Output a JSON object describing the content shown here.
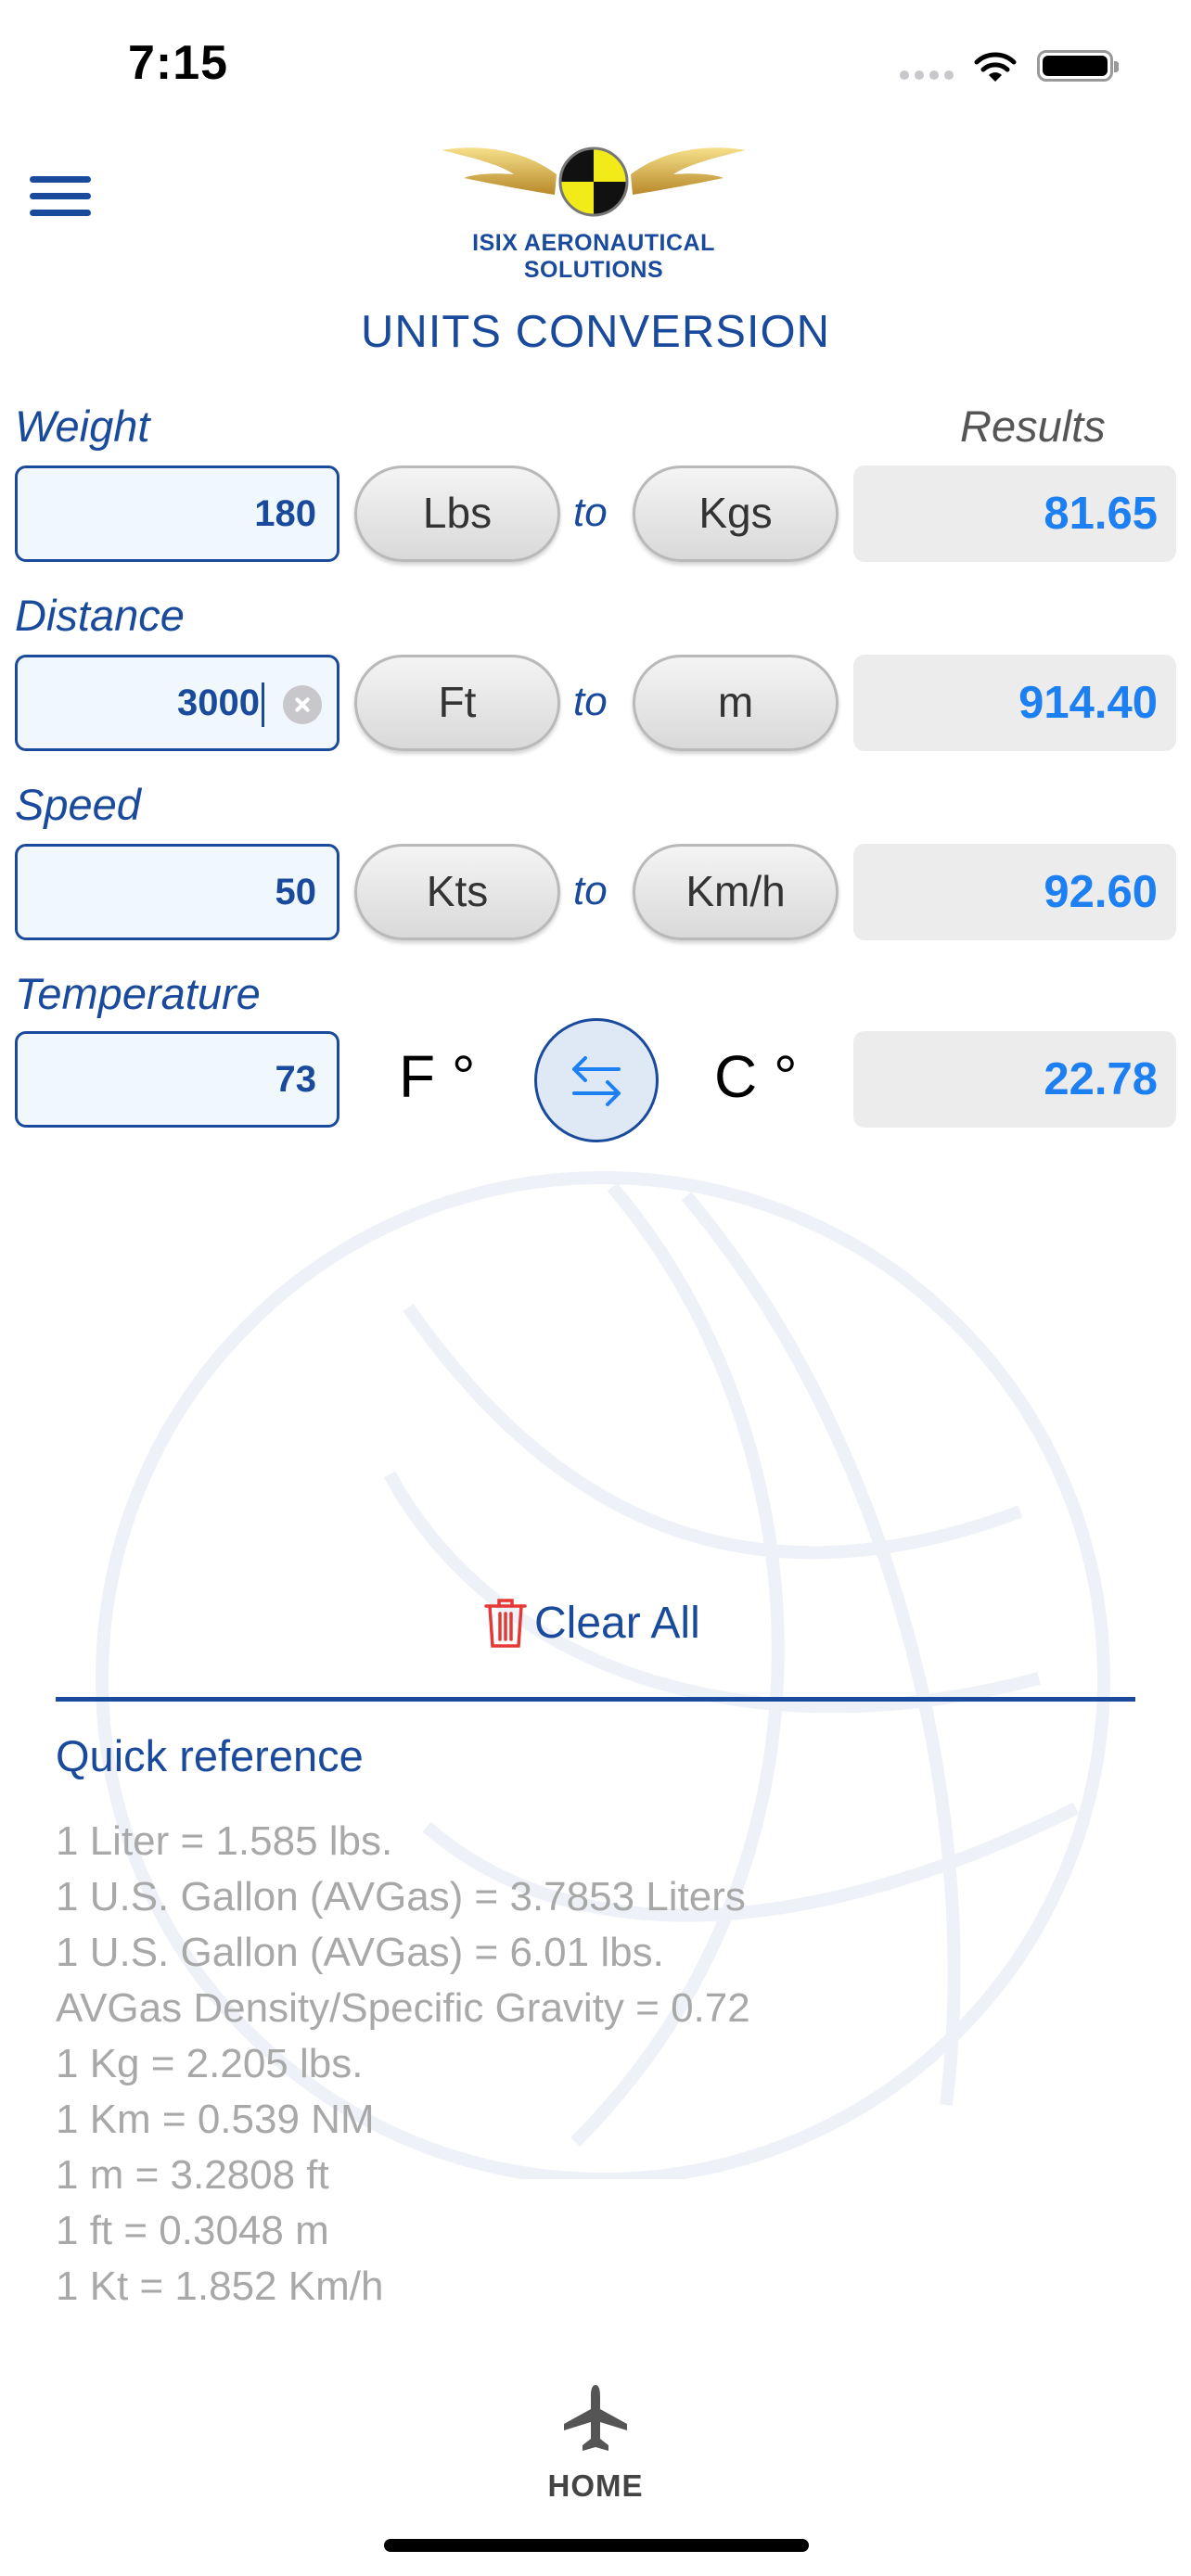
{
  "status_bar": {
    "time": "7:15"
  },
  "header": {
    "logo_text": "ISIX   AERONAUTICAL SOLUTIONS",
    "title": "UNITS CONVERSION"
  },
  "converter": {
    "results_label": "Results",
    "rows": [
      {
        "label": "Weight",
        "input": "180",
        "from_unit": "Lbs",
        "to": "to",
        "to_unit": "Kgs",
        "result": "81.65"
      },
      {
        "label": "Distance",
        "input": "3000",
        "from_unit": "Ft",
        "to": "to",
        "to_unit": "m",
        "result": "914.40"
      },
      {
        "label": "Speed",
        "input": "50",
        "from_unit": "Kts",
        "to": "to",
        "to_unit": "Km/h",
        "result": "92.60"
      }
    ],
    "temperature": {
      "label": "Temperature",
      "input": "73",
      "from_unit": "F °",
      "to_unit": "C °",
      "result": "22.78"
    }
  },
  "clear_all_label": "Clear All",
  "quick_reference": {
    "title": "Quick reference",
    "items": [
      "1  Liter = 1.585 lbs.",
      "1  U.S. Gallon (AVGas) = 3.7853 Liters",
      "1  U.S. Gallon (AVGas) = 6.01 lbs.",
      "AVGas Density/Specific Gravity = 0.72",
      "1  Kg = 2.205 lbs.",
      "1  Km = 0.539 NM",
      "1  m = 3.2808 ft",
      "1  ft = 0.3048 m",
      "1  Kt = 1.852 Km/h"
    ]
  },
  "tab_bar": {
    "home_label": "HOME",
    "icon": "airplane-icon"
  },
  "colors": {
    "primary": "#1a4a9c",
    "result_text": "#1c7ff2",
    "clear_icon": "#e53935",
    "reference_text": "#a8a8a8"
  }
}
